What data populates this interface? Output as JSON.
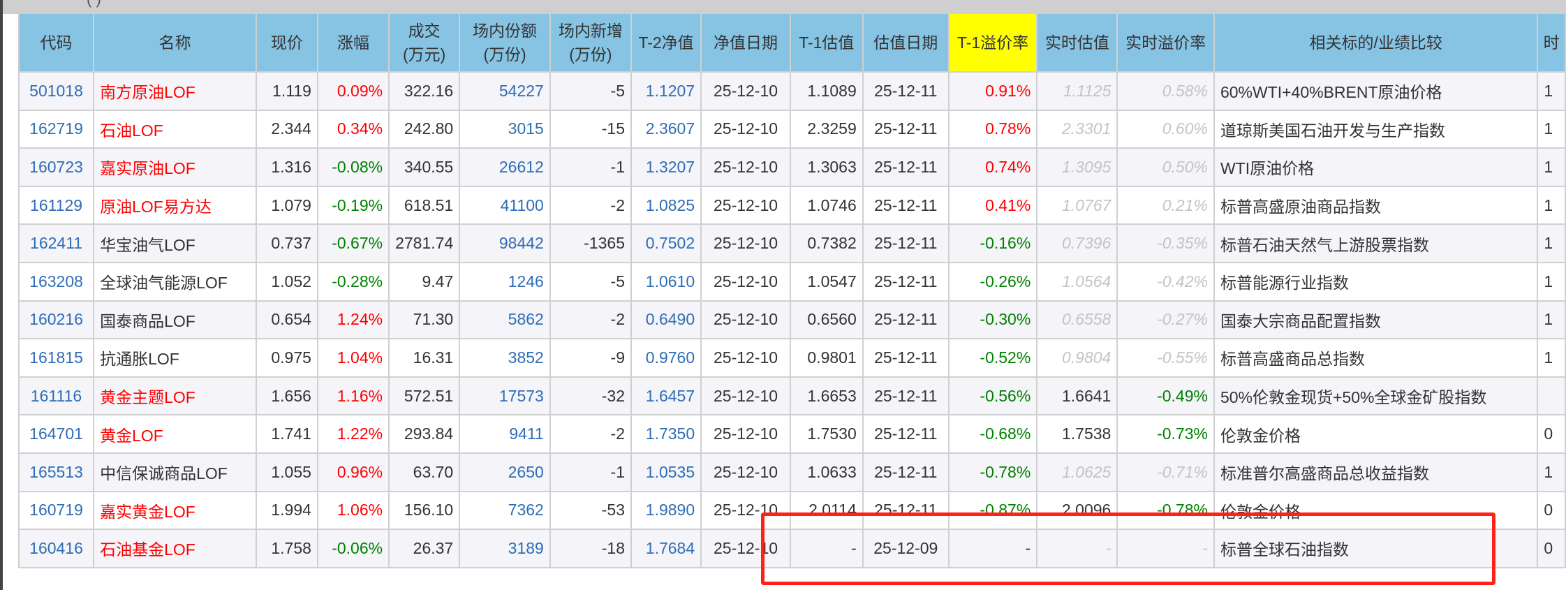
{
  "topbar_text": "( )",
  "headers": [
    "代码",
    "名称",
    "现价",
    "涨幅",
    "成交\n(万元)",
    "场内份额\n(万份)",
    "场内新增\n(万份)",
    "T-2净值",
    "净值日期",
    "T-1估值",
    "估值日期",
    "T-1溢价率",
    "实时估值",
    "实时溢价率",
    "相关标的/业绩比较",
    "时"
  ],
  "colors": {
    "header_bg": "#87c4e4",
    "highlight_header": "#ffff00",
    "up": "#ff0000",
    "down": "#008000",
    "link": "#2f6db5",
    "annotation_box": "#ff2018"
  },
  "rows": [
    {
      "code": "501018",
      "name": "南方原油LOF",
      "name_red": true,
      "price": "1.119",
      "change": "0.09%",
      "volume": "322.16",
      "shares": "54227",
      "new_shares": "-5",
      "nav_t2": "1.1207",
      "nav_date": "25-12-10",
      "est_t1": "1.1089",
      "est_date": "25-12-11",
      "premium_t1": "0.91%",
      "rt_est": "1.1125",
      "rt_est_stale": true,
      "rt_premium": "0.58%",
      "benchmark": "60%WTI+40%BRENT原油价格",
      "extra": "1"
    },
    {
      "code": "162719",
      "name": "石油LOF",
      "name_red": true,
      "price": "2.344",
      "change": "0.34%",
      "volume": "242.80",
      "shares": "3015",
      "new_shares": "-15",
      "nav_t2": "2.3607",
      "nav_date": "25-12-10",
      "est_t1": "2.3259",
      "est_date": "25-12-11",
      "premium_t1": "0.78%",
      "rt_est": "2.3301",
      "rt_est_stale": true,
      "rt_premium": "0.60%",
      "benchmark": "道琼斯美国石油开发与生产指数",
      "extra": "1"
    },
    {
      "code": "160723",
      "name": "嘉实原油LOF",
      "name_red": true,
      "price": "1.316",
      "change": "-0.08%",
      "volume": "340.55",
      "shares": "26612",
      "new_shares": "-1",
      "nav_t2": "1.3207",
      "nav_date": "25-12-10",
      "est_t1": "1.3063",
      "est_date": "25-12-11",
      "premium_t1": "0.74%",
      "rt_est": "1.3095",
      "rt_est_stale": true,
      "rt_premium": "0.50%",
      "benchmark": "WTI原油价格",
      "extra": "1"
    },
    {
      "code": "161129",
      "name": "原油LOF易方达",
      "name_red": true,
      "price": "1.079",
      "change": "-0.19%",
      "volume": "618.51",
      "shares": "41100",
      "new_shares": "-2",
      "nav_t2": "1.0825",
      "nav_date": "25-12-10",
      "est_t1": "1.0746",
      "est_date": "25-12-11",
      "premium_t1": "0.41%",
      "rt_est": "1.0767",
      "rt_est_stale": true,
      "rt_premium": "0.21%",
      "benchmark": "标普高盛原油商品指数",
      "extra": "1"
    },
    {
      "code": "162411",
      "name": "华宝油气LOF",
      "name_red": false,
      "price": "0.737",
      "change": "-0.67%",
      "volume": "2781.74",
      "shares": "98442",
      "new_shares": "-1365",
      "nav_t2": "0.7502",
      "nav_date": "25-12-10",
      "est_t1": "0.7382",
      "est_date": "25-12-11",
      "premium_t1": "-0.16%",
      "rt_est": "0.7396",
      "rt_est_stale": true,
      "rt_premium": "-0.35%",
      "benchmark": "标普石油天然气上游股票指数",
      "extra": "1"
    },
    {
      "code": "163208",
      "name": "全球油气能源LOF",
      "name_red": false,
      "price": "1.052",
      "change": "-0.28%",
      "volume": "9.47",
      "shares": "1246",
      "new_shares": "-5",
      "nav_t2": "1.0610",
      "nav_date": "25-12-10",
      "est_t1": "1.0547",
      "est_date": "25-12-11",
      "premium_t1": "-0.26%",
      "rt_est": "1.0564",
      "rt_est_stale": true,
      "rt_premium": "-0.42%",
      "benchmark": "标普能源行业指数",
      "extra": "1"
    },
    {
      "code": "160216",
      "name": "国泰商品LOF",
      "name_red": false,
      "price": "0.654",
      "change": "1.24%",
      "volume": "71.30",
      "shares": "5862",
      "new_shares": "-2",
      "nav_t2": "0.6490",
      "nav_date": "25-12-10",
      "est_t1": "0.6560",
      "est_date": "25-12-11",
      "premium_t1": "-0.30%",
      "rt_est": "0.6558",
      "rt_est_stale": true,
      "rt_premium": "-0.27%",
      "benchmark": "国泰大宗商品配置指数",
      "extra": "1"
    },
    {
      "code": "161815",
      "name": "抗通胀LOF",
      "name_red": false,
      "price": "0.975",
      "change": "1.04%",
      "volume": "16.31",
      "shares": "3852",
      "new_shares": "-9",
      "nav_t2": "0.9760",
      "nav_date": "25-12-10",
      "est_t1": "0.9801",
      "est_date": "25-12-11",
      "premium_t1": "-0.52%",
      "rt_est": "0.9804",
      "rt_est_stale": true,
      "rt_premium": "-0.55%",
      "benchmark": "标普高盛商品总指数",
      "extra": "1"
    },
    {
      "code": "161116",
      "name": "黄金主题LOF",
      "name_red": true,
      "price": "1.656",
      "change": "1.16%",
      "volume": "572.51",
      "shares": "17573",
      "new_shares": "-32",
      "nav_t2": "1.6457",
      "nav_date": "25-12-10",
      "est_t1": "1.6653",
      "est_date": "25-12-11",
      "premium_t1": "-0.56%",
      "rt_est": "1.6641",
      "rt_est_stale": false,
      "rt_premium": "-0.49%",
      "benchmark": "50%伦敦金现货+50%全球金矿股指数",
      "extra": ""
    },
    {
      "code": "164701",
      "name": "黄金LOF",
      "name_red": true,
      "price": "1.741",
      "change": "1.22%",
      "volume": "293.84",
      "shares": "9411",
      "new_shares": "-2",
      "nav_t2": "1.7350",
      "nav_date": "25-12-10",
      "est_t1": "1.7530",
      "est_date": "25-12-11",
      "premium_t1": "-0.68%",
      "rt_est": "1.7538",
      "rt_est_stale": false,
      "rt_premium": "-0.73%",
      "benchmark": "伦敦金价格",
      "extra": "0"
    },
    {
      "code": "165513",
      "name": "中信保诚商品LOF",
      "name_red": false,
      "price": "1.055",
      "change": "0.96%",
      "volume": "63.70",
      "shares": "2650",
      "new_shares": "-1",
      "nav_t2": "1.0535",
      "nav_date": "25-12-10",
      "est_t1": "1.0633",
      "est_date": "25-12-11",
      "premium_t1": "-0.78%",
      "rt_est": "1.0625",
      "rt_est_stale": true,
      "rt_premium": "-0.71%",
      "benchmark": "标准普尔高盛商品总收益指数",
      "extra": "1"
    },
    {
      "code": "160719",
      "name": "嘉实黄金LOF",
      "name_red": true,
      "price": "1.994",
      "change": "1.06%",
      "volume": "156.10",
      "shares": "7362",
      "new_shares": "-53",
      "nav_t2": "1.9890",
      "nav_date": "25-12-10",
      "est_t1": "2.0114",
      "est_date": "25-12-11",
      "premium_t1": "-0.87%",
      "rt_est": "2.0096",
      "rt_est_stale": false,
      "rt_premium": "-0.78%",
      "benchmark": "伦敦金价格",
      "extra": "0"
    },
    {
      "code": "160416",
      "name": "石油基金LOF",
      "name_red": true,
      "price": "1.758",
      "change": "-0.06%",
      "volume": "26.37",
      "shares": "3189",
      "new_shares": "-18",
      "nav_t2": "1.7684",
      "nav_date": "25-12-10",
      "est_t1": "-",
      "est_date": "25-12-09",
      "premium_t1": "-",
      "rt_est": "-",
      "rt_est_stale": true,
      "rt_premium": "-",
      "benchmark": "标普全球石油指数",
      "extra": "0"
    }
  ]
}
